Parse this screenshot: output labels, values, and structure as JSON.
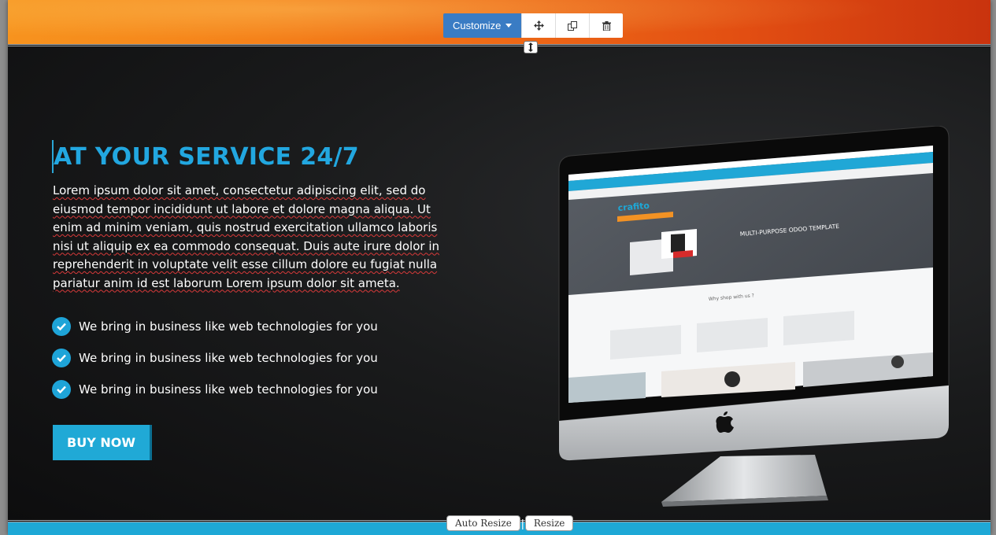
{
  "toolbar": {
    "customize_label": "Customize",
    "icons": [
      "move-icon",
      "clone-icon",
      "trash-icon"
    ]
  },
  "hero": {
    "headline": "AT YOUR SERVICE 24/7",
    "paragraph": "Lorem ipsum dolor sit amet, consectetur adipiscing elit, sed do eiusmod tempor incididunt ut labore et dolore magna aliqua. Ut enim ad minim veniam, quis nostrud exercitation ullamco laboris nisi ut aliquip ex ea commodo consequat. Duis aute irure dolor in reprehenderit in voluptate velit esse cillum dolore eu fugiat nulla pariatur anim id est laborum Lorem ipsum dolor sit ameta.",
    "features": [
      "We bring in business like web technologies for you",
      "We bring in business like web technologies for you",
      "We bring in business like web technologies for you"
    ],
    "cta_label": "BUY NOW"
  },
  "screen": {
    "brand": "crafito",
    "banner_title": "MULTI-PURPOSE ODOO TEMPLATE",
    "section_title": "Why shop with us ?"
  },
  "resize": {
    "auto_label": "Auto Resize",
    "resize_label": "Resize"
  },
  "colors": {
    "accent": "#22a7e0",
    "toolbar_blue": "#3a7cc4",
    "top_band_left": "#f7931e",
    "top_band_right": "#c9330e"
  }
}
